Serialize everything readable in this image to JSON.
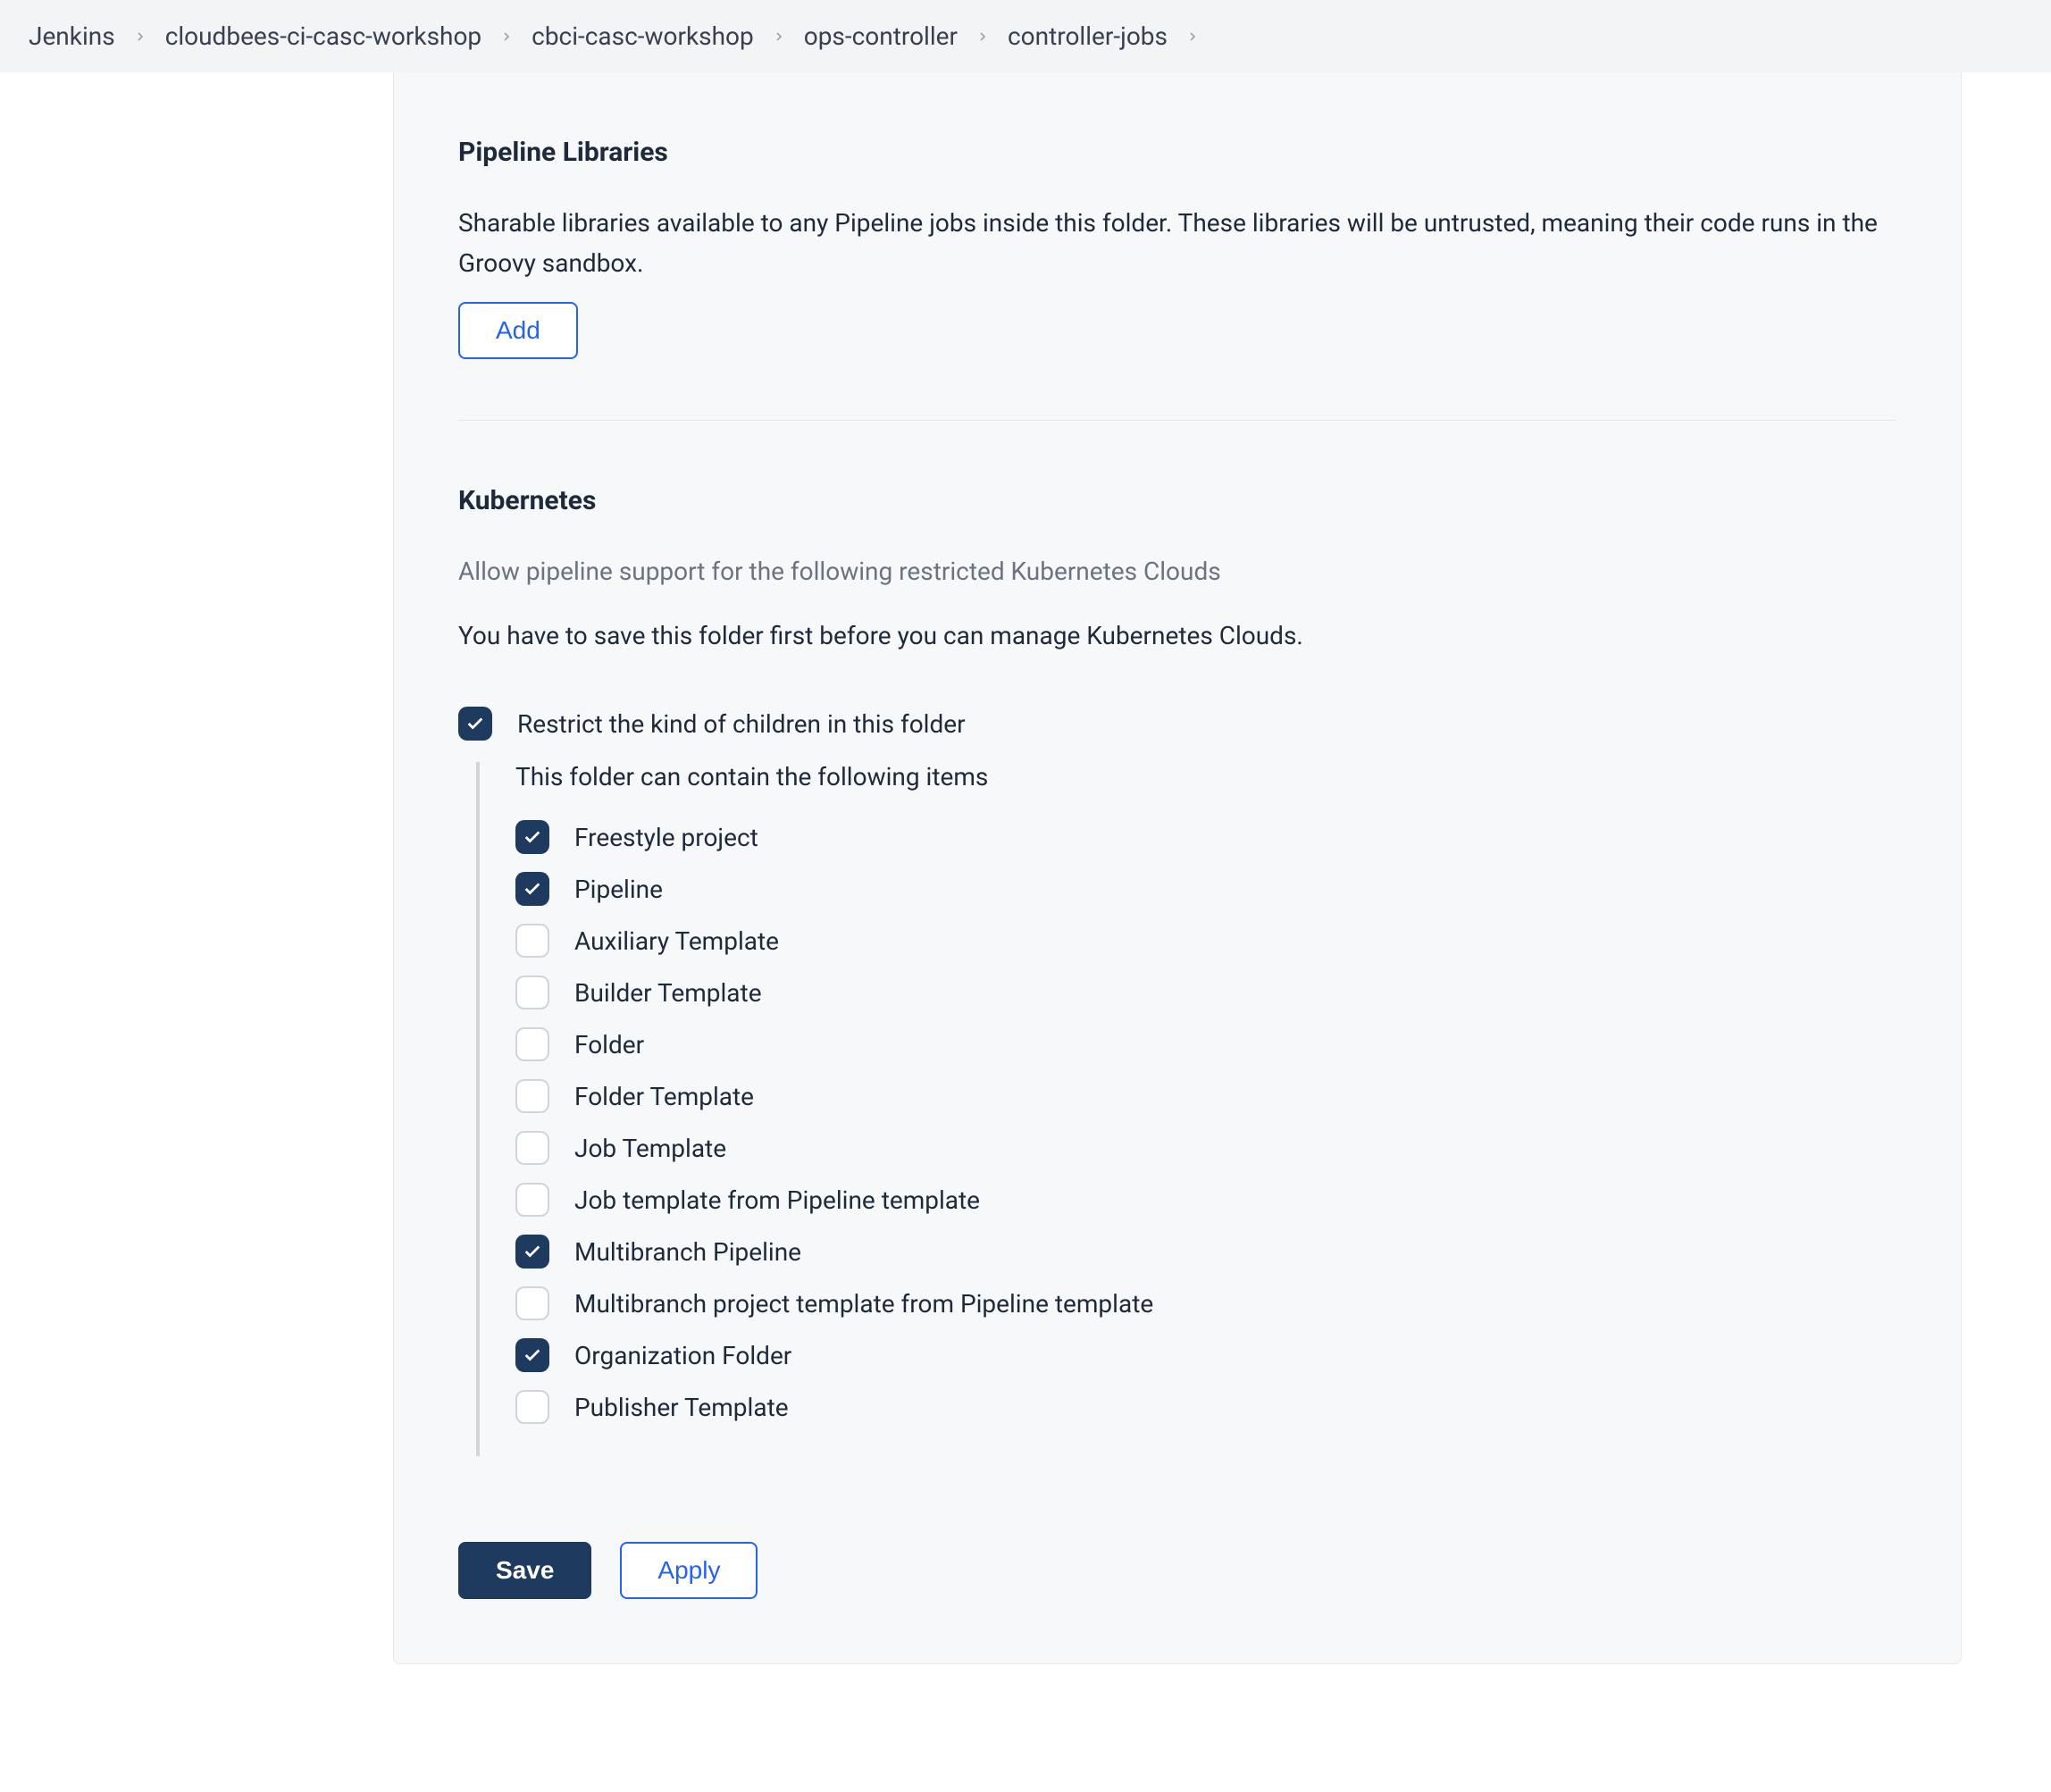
{
  "breadcrumbs": [
    {
      "label": "Jenkins"
    },
    {
      "label": "cloudbees-ci-casc-workshop"
    },
    {
      "label": "cbci-casc-workshop"
    },
    {
      "label": "ops-controller"
    },
    {
      "label": "controller-jobs"
    }
  ],
  "pipeline_libraries": {
    "title": "Pipeline Libraries",
    "description": "Sharable libraries available to any Pipeline jobs inside this folder. These libraries will be untrusted, meaning their code runs in the Groovy sandbox.",
    "add_button": "Add"
  },
  "kubernetes": {
    "title": "Kubernetes",
    "subdescription": "Allow pipeline support for the following restricted Kubernetes Clouds",
    "notice": "You have to save this folder first before you can manage Kubernetes Clouds."
  },
  "restrict_children": {
    "label": "Restrict the kind of children in this folder",
    "checked": true,
    "sublabel": "This folder can contain the following items",
    "items": [
      {
        "label": "Freestyle project",
        "checked": true
      },
      {
        "label": "Pipeline",
        "checked": true
      },
      {
        "label": "Auxiliary Template",
        "checked": false
      },
      {
        "label": "Builder Template",
        "checked": false
      },
      {
        "label": "Folder",
        "checked": false
      },
      {
        "label": "Folder Template",
        "checked": false
      },
      {
        "label": "Job Template",
        "checked": false
      },
      {
        "label": "Job template from Pipeline template",
        "checked": false
      },
      {
        "label": "Multibranch Pipeline",
        "checked": true
      },
      {
        "label": "Multibranch project template from Pipeline template",
        "checked": false
      },
      {
        "label": "Organization Folder",
        "checked": true
      },
      {
        "label": "Publisher Template",
        "checked": false
      }
    ]
  },
  "buttons": {
    "save": "Save",
    "apply": "Apply"
  }
}
